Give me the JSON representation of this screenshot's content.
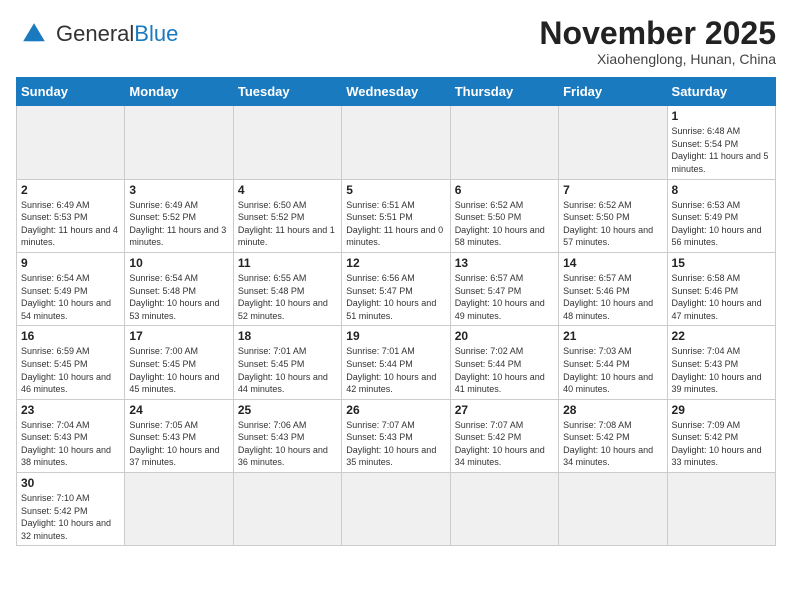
{
  "header": {
    "logo_general": "General",
    "logo_blue": "Blue",
    "month": "November 2025",
    "location": "Xiaohenglong, Hunan, China"
  },
  "weekdays": [
    "Sunday",
    "Monday",
    "Tuesday",
    "Wednesday",
    "Thursday",
    "Friday",
    "Saturday"
  ],
  "weeks": [
    [
      {
        "day": "",
        "empty": true
      },
      {
        "day": "",
        "empty": true
      },
      {
        "day": "",
        "empty": true
      },
      {
        "day": "",
        "empty": true
      },
      {
        "day": "",
        "empty": true
      },
      {
        "day": "",
        "empty": true
      },
      {
        "day": "1",
        "sunrise": "6:48 AM",
        "sunset": "5:54 PM",
        "daylight": "11 hours and 5 minutes."
      }
    ],
    [
      {
        "day": "2",
        "sunrise": "6:49 AM",
        "sunset": "5:53 PM",
        "daylight": "11 hours and 4 minutes."
      },
      {
        "day": "3",
        "sunrise": "6:49 AM",
        "sunset": "5:52 PM",
        "daylight": "11 hours and 3 minutes."
      },
      {
        "day": "4",
        "sunrise": "6:50 AM",
        "sunset": "5:52 PM",
        "daylight": "11 hours and 1 minute."
      },
      {
        "day": "5",
        "sunrise": "6:51 AM",
        "sunset": "5:51 PM",
        "daylight": "11 hours and 0 minutes."
      },
      {
        "day": "6",
        "sunrise": "6:52 AM",
        "sunset": "5:50 PM",
        "daylight": "10 hours and 58 minutes."
      },
      {
        "day": "7",
        "sunrise": "6:52 AM",
        "sunset": "5:50 PM",
        "daylight": "10 hours and 57 minutes."
      },
      {
        "day": "8",
        "sunrise": "6:53 AM",
        "sunset": "5:49 PM",
        "daylight": "10 hours and 56 minutes."
      }
    ],
    [
      {
        "day": "9",
        "sunrise": "6:54 AM",
        "sunset": "5:49 PM",
        "daylight": "10 hours and 54 minutes."
      },
      {
        "day": "10",
        "sunrise": "6:54 AM",
        "sunset": "5:48 PM",
        "daylight": "10 hours and 53 minutes."
      },
      {
        "day": "11",
        "sunrise": "6:55 AM",
        "sunset": "5:48 PM",
        "daylight": "10 hours and 52 minutes."
      },
      {
        "day": "12",
        "sunrise": "6:56 AM",
        "sunset": "5:47 PM",
        "daylight": "10 hours and 51 minutes."
      },
      {
        "day": "13",
        "sunrise": "6:57 AM",
        "sunset": "5:47 PM",
        "daylight": "10 hours and 49 minutes."
      },
      {
        "day": "14",
        "sunrise": "6:57 AM",
        "sunset": "5:46 PM",
        "daylight": "10 hours and 48 minutes."
      },
      {
        "day": "15",
        "sunrise": "6:58 AM",
        "sunset": "5:46 PM",
        "daylight": "10 hours and 47 minutes."
      }
    ],
    [
      {
        "day": "16",
        "sunrise": "6:59 AM",
        "sunset": "5:45 PM",
        "daylight": "10 hours and 46 minutes."
      },
      {
        "day": "17",
        "sunrise": "7:00 AM",
        "sunset": "5:45 PM",
        "daylight": "10 hours and 45 minutes."
      },
      {
        "day": "18",
        "sunrise": "7:01 AM",
        "sunset": "5:45 PM",
        "daylight": "10 hours and 44 minutes."
      },
      {
        "day": "19",
        "sunrise": "7:01 AM",
        "sunset": "5:44 PM",
        "daylight": "10 hours and 42 minutes."
      },
      {
        "day": "20",
        "sunrise": "7:02 AM",
        "sunset": "5:44 PM",
        "daylight": "10 hours and 41 minutes."
      },
      {
        "day": "21",
        "sunrise": "7:03 AM",
        "sunset": "5:44 PM",
        "daylight": "10 hours and 40 minutes."
      },
      {
        "day": "22",
        "sunrise": "7:04 AM",
        "sunset": "5:43 PM",
        "daylight": "10 hours and 39 minutes."
      }
    ],
    [
      {
        "day": "23",
        "sunrise": "7:04 AM",
        "sunset": "5:43 PM",
        "daylight": "10 hours and 38 minutes."
      },
      {
        "day": "24",
        "sunrise": "7:05 AM",
        "sunset": "5:43 PM",
        "daylight": "10 hours and 37 minutes."
      },
      {
        "day": "25",
        "sunrise": "7:06 AM",
        "sunset": "5:43 PM",
        "daylight": "10 hours and 36 minutes."
      },
      {
        "day": "26",
        "sunrise": "7:07 AM",
        "sunset": "5:43 PM",
        "daylight": "10 hours and 35 minutes."
      },
      {
        "day": "27",
        "sunrise": "7:07 AM",
        "sunset": "5:42 PM",
        "daylight": "10 hours and 34 minutes."
      },
      {
        "day": "28",
        "sunrise": "7:08 AM",
        "sunset": "5:42 PM",
        "daylight": "10 hours and 34 minutes."
      },
      {
        "day": "29",
        "sunrise": "7:09 AM",
        "sunset": "5:42 PM",
        "daylight": "10 hours and 33 minutes."
      }
    ],
    [
      {
        "day": "30",
        "sunrise": "7:10 AM",
        "sunset": "5:42 PM",
        "daylight": "10 hours and 32 minutes."
      },
      {
        "day": "",
        "empty": true
      },
      {
        "day": "",
        "empty": true
      },
      {
        "day": "",
        "empty": true
      },
      {
        "day": "",
        "empty": true
      },
      {
        "day": "",
        "empty": true
      },
      {
        "day": "",
        "empty": true
      }
    ]
  ],
  "labels": {
    "sunrise": "Sunrise: ",
    "sunset": "Sunset: ",
    "daylight": "Daylight: "
  }
}
